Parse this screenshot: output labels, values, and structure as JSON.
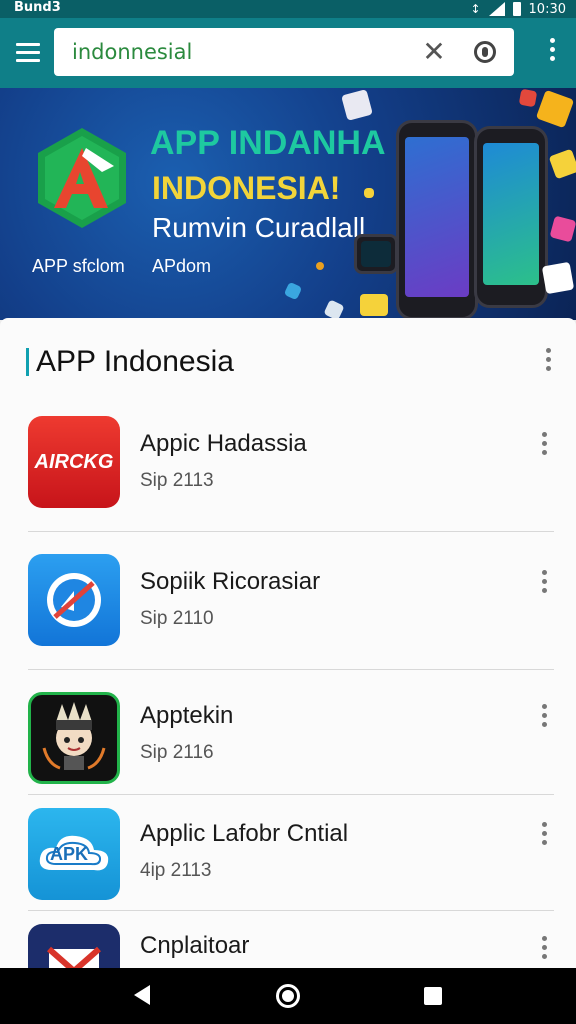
{
  "status_bar": {
    "left_text": "Bund3",
    "time": "10:30"
  },
  "search": {
    "value": "indonnesial",
    "placeholder": ""
  },
  "banner": {
    "title": "APP INDANHA",
    "subtitle": "INDONESIA!",
    "tagline": "Rumvin Curadlall",
    "caption_left": "APP sfclom",
    "caption_right": "APdom",
    "logo_letter": "A"
  },
  "section": {
    "title": "APP Indonesia"
  },
  "apps": [
    {
      "name": "Appic Hadassia",
      "meta": "Sip 2113",
      "icon_text": "AIRCKG",
      "icon": "red-tile-icon"
    },
    {
      "name": "Sopiik Ricorasiar",
      "meta": "Sip 2110",
      "icon_text": "",
      "icon": "blue-circle-slash-icon"
    },
    {
      "name": "Apptekin",
      "meta": "Sip 2116",
      "icon_text": "",
      "icon": "anime-character-icon"
    },
    {
      "name": "Applic Lafobr Cntial",
      "meta": "4ip 2113",
      "icon_text": "APK",
      "icon": "cloud-apk-icon"
    },
    {
      "name": "Cnplaitoar",
      "meta": "",
      "icon_text": "",
      "icon": "gmail-style-icon"
    }
  ],
  "colors": {
    "app_bar": "#0f7f88",
    "status_bar": "#0a5f66",
    "accent": "#10a0b0",
    "banner_title": "#1ec9a0",
    "banner_subtitle": "#f2d43a"
  }
}
